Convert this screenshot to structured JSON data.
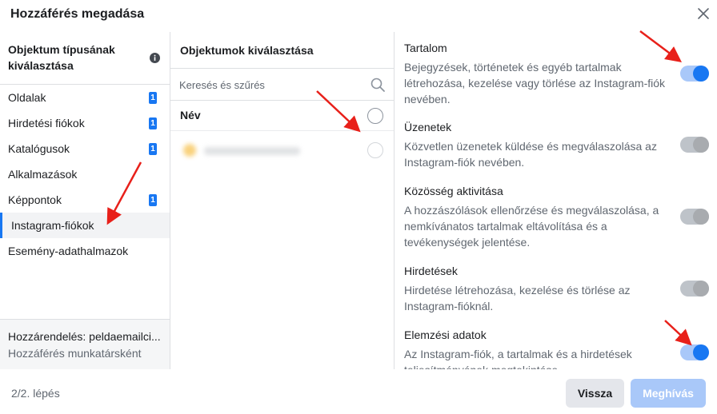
{
  "dialog": {
    "title": "Hozzáférés megadása",
    "close_icon": "close-icon"
  },
  "object_types": {
    "header": "Objektum típusának kiválasztása",
    "info_icon": "info-icon",
    "items": [
      {
        "label": "Oldalak",
        "badge": "1"
      },
      {
        "label": "Hirdetési fiókok",
        "badge": "1"
      },
      {
        "label": "Katalógusok",
        "badge": "1"
      },
      {
        "label": "Alkalmazások",
        "badge": ""
      },
      {
        "label": "Képpontok",
        "badge": "1"
      },
      {
        "label": "Instagram-fiókok",
        "badge": ""
      },
      {
        "label": "Esemény-adathalmazok",
        "badge": ""
      }
    ],
    "selected": "Instagram-fiókok",
    "footer_line1": "Hozzárendelés: peldaemailci...",
    "footer_line2": "Hozzáférés munkatársként"
  },
  "objects": {
    "header": "Objektumok kiválasztása",
    "search_placeholder": "Keresés és szűrés",
    "search_icon": "search-icon",
    "name_header": "Név"
  },
  "permissions": [
    {
      "title": "Tartalom",
      "description": "Bejegyzések, történetek és egyéb tartalmak létrehozása, kezelése vagy törlése az Instagram-fiók nevében.",
      "enabled": true
    },
    {
      "title": "Üzenetek",
      "description": "Közvetlen üzenetek küldése és megválaszolása az Instagram-fiók nevében.",
      "enabled": false
    },
    {
      "title": "Közösség aktivitása",
      "description": "A hozzászólások ellenőrzése és megválaszolása, a nemkívánatos tartalmak eltávolítása és a tevékenységek jelentése.",
      "enabled": false
    },
    {
      "title": "Hirdetések",
      "description": "Hirdetése létrehozása, kezelése és törlése az Instagram-fióknál.",
      "enabled": false
    },
    {
      "title": "Elemzési adatok",
      "description": "Az Instagram-fiók, a tartalmak és a hirdetések teljesítményének megtekintése.",
      "enabled": true
    }
  ],
  "footer": {
    "step": "2/2. lépés",
    "back_label": "Vissza",
    "grant_label": "Meghívás"
  },
  "colors": {
    "accent": "#1877f2",
    "annotation": "#e8201a"
  }
}
